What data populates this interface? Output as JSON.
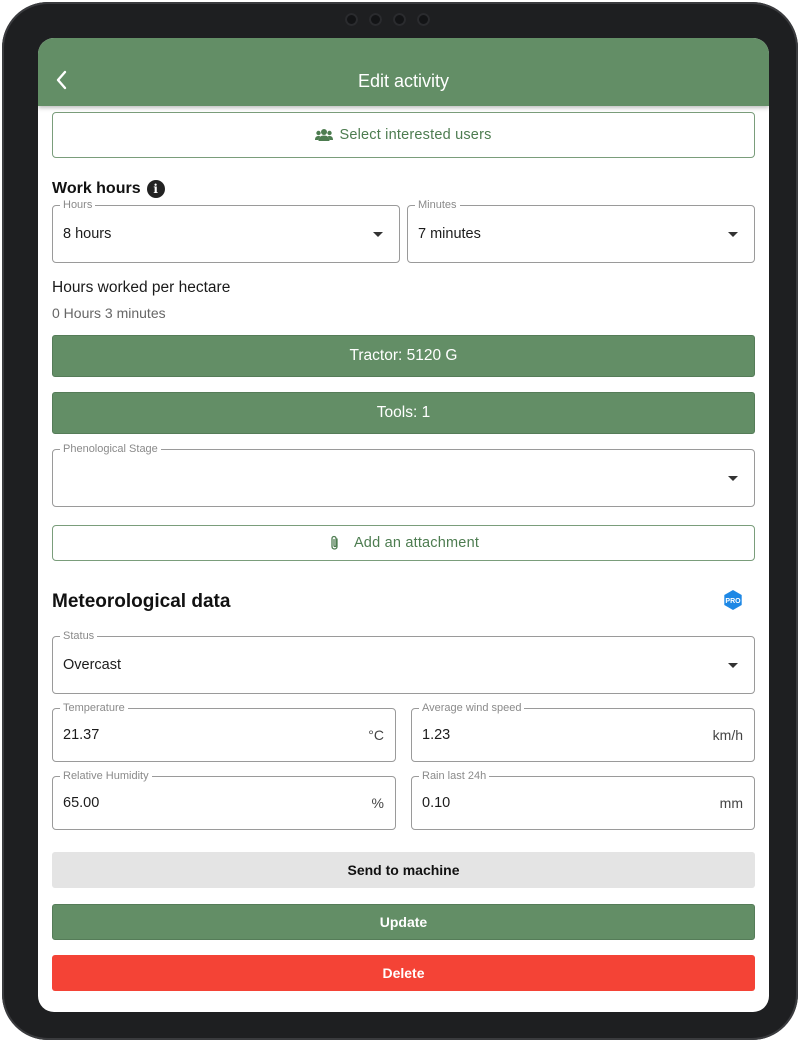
{
  "header": {
    "title": "Edit activity",
    "back_icon": "chevron-left-icon"
  },
  "interested_users": {
    "label": "Select interested users",
    "icon": "users-icon"
  },
  "work_hours": {
    "title": "Work hours",
    "info_icon": "i",
    "hours": {
      "legend": "Hours",
      "value": "8 hours"
    },
    "minutes": {
      "legend": "Minutes",
      "value": "7 minutes"
    }
  },
  "per_hectare": {
    "title": "Hours worked per hectare",
    "value": "0 Hours 3 minutes"
  },
  "tractor": {
    "label": "Tractor: 5120 G"
  },
  "tools": {
    "label": "Tools: 1"
  },
  "phenological": {
    "legend": "Phenological Stage",
    "value": ""
  },
  "attachment": {
    "label": "Add an attachment",
    "icon": "paperclip-icon"
  },
  "meteo": {
    "title": "Meteorological data",
    "pro_badge": "PRO",
    "status": {
      "legend": "Status",
      "value": "Overcast"
    },
    "temperature": {
      "legend": "Temperature",
      "value": "21.37",
      "unit": "°C"
    },
    "wind": {
      "legend": "Average wind speed",
      "value": "1.23",
      "unit": "km/h"
    },
    "humidity": {
      "legend": "Relative Humidity",
      "value": "65.00",
      "unit": "%"
    },
    "rain": {
      "legend": "Rain last 24h",
      "value": "0.10",
      "unit": "mm"
    }
  },
  "actions": {
    "send": "Send to machine",
    "update": "Update",
    "delete": "Delete"
  },
  "colors": {
    "primary_green": "#638e66",
    "danger_red": "#f44336",
    "pro_blue": "#1e88e5",
    "neutral_grey": "#e4e4e4"
  }
}
